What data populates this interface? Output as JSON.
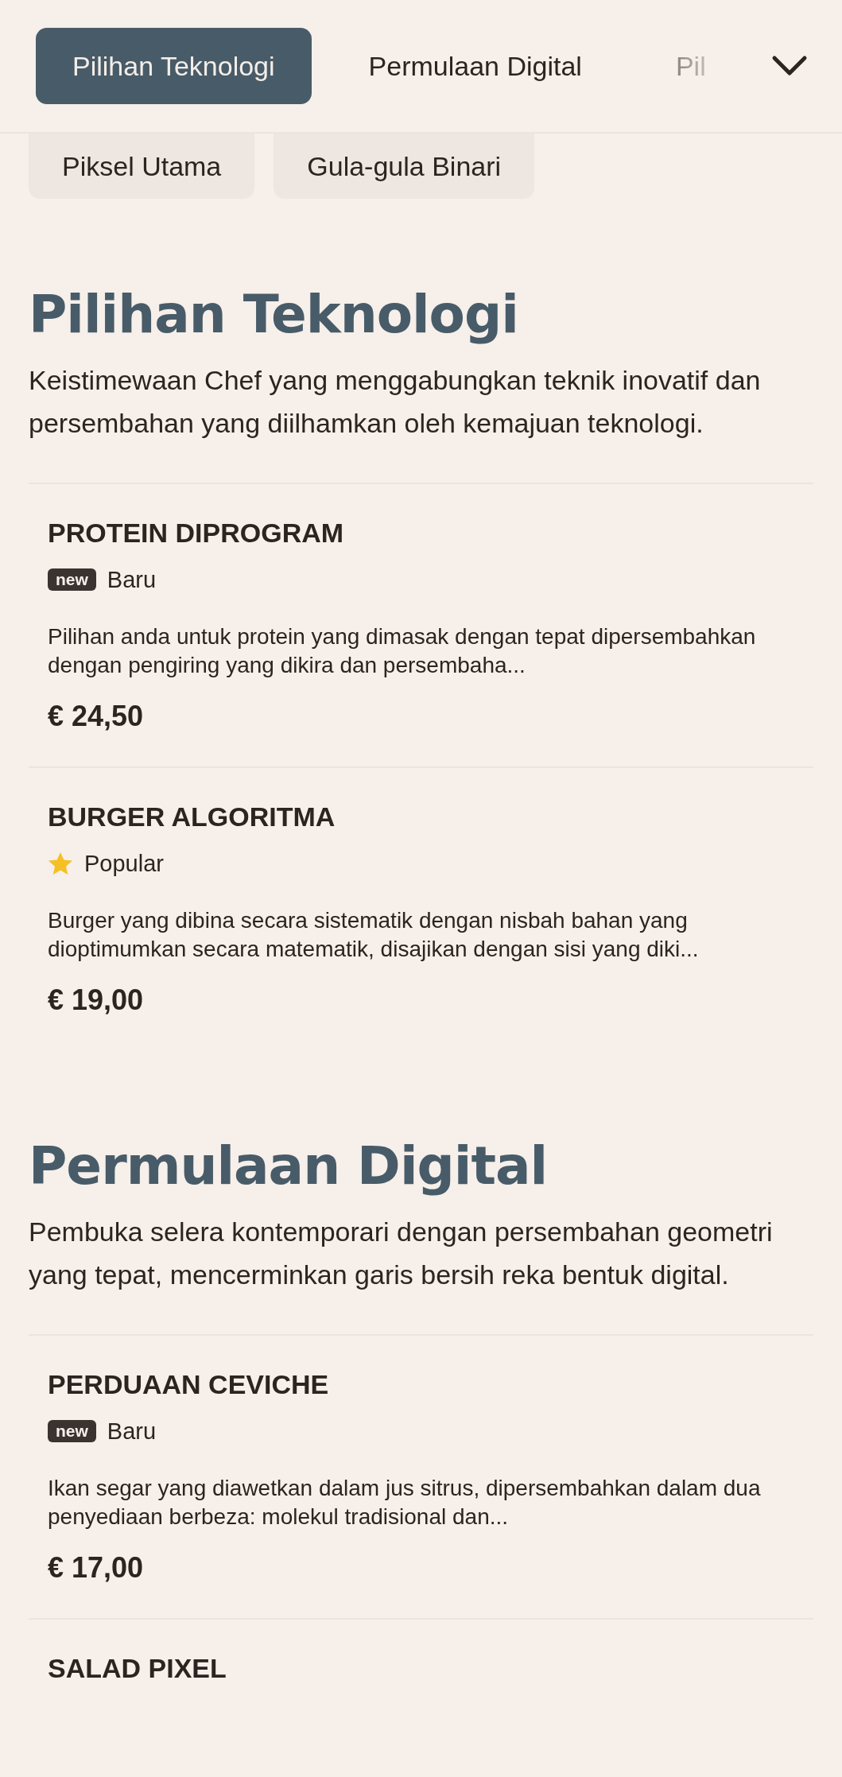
{
  "tabs": [
    {
      "label": "Pilihan Teknologi",
      "selected": true
    },
    {
      "label": "Permulaan Digital",
      "selected": false
    },
    {
      "label": "Pil",
      "selected": false
    }
  ],
  "more_tabs": [
    {
      "label": "Piksel Utama",
      "selected": false
    },
    {
      "label": "Gula-gula Binari",
      "selected": false
    }
  ],
  "sections": [
    {
      "title": "Pilihan Teknologi",
      "description": "Keistimewaan Chef yang menggabungkan teknik inovatif dan persembahan yang diilhamkan oleh kemajuan teknologi.",
      "items": [
        {
          "name": "PROTEIN DIPROGRAM",
          "badge": {
            "kind": "new",
            "tag": "new",
            "label": "Baru"
          },
          "description": "Pilihan anda untuk protein yang dimasak dengan tepat dipersembahkan dengan pengiring yang dikira dan persembaha...",
          "price": "€ 24,50"
        },
        {
          "name": "BURGER ALGORITMA",
          "badge": {
            "kind": "star",
            "label": "Popular"
          },
          "description": "Burger yang dibina secara sistematik dengan nisbah bahan yang dioptimumkan secara matematik, disajikan dengan sisi yang diki...",
          "price": "€ 19,00"
        }
      ]
    },
    {
      "title": "Permulaan Digital",
      "description": "Pembuka selera kontemporari dengan persembahan geometri yang tepat, mencerminkan garis bersih reka bentuk digital.",
      "items": [
        {
          "name": "PERDUAAN CEVICHE",
          "badge": {
            "kind": "new",
            "tag": "new",
            "label": "Baru"
          },
          "description": "Ikan segar yang diawetkan dalam jus sitrus, dipersembahkan dalam dua penyediaan berbeza: molekul tradisional dan...",
          "price": "€ 17,00"
        },
        {
          "name": "SALAD PIXEL"
        }
      ]
    }
  ]
}
